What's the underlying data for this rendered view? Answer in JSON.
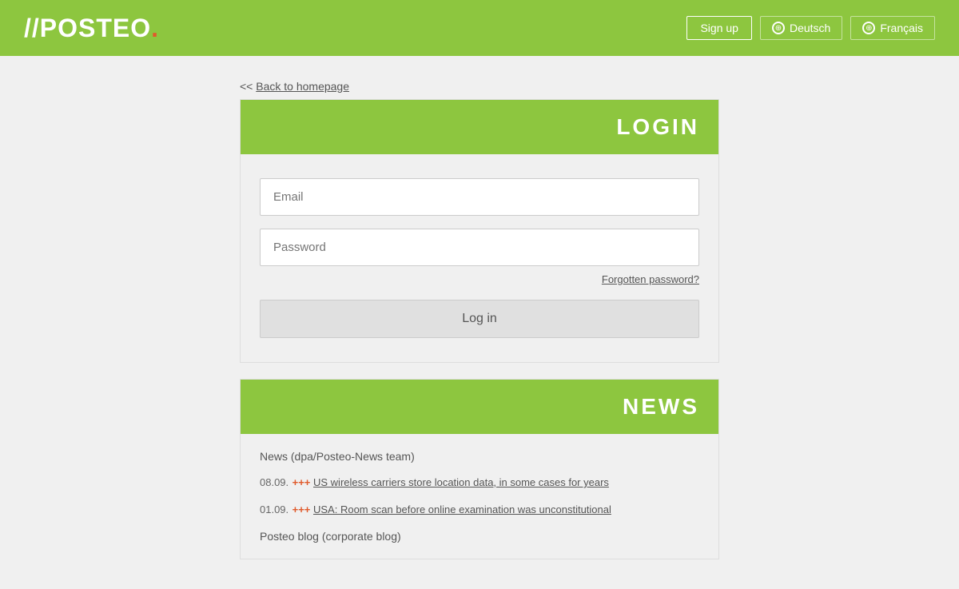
{
  "header": {
    "logo": "//POSTEO",
    "dot": ".",
    "signup_label": "Sign up",
    "lang_deutsch": "Deutsch",
    "lang_francais": "Français"
  },
  "back_link": {
    "prefix": "<< ",
    "label": "Back to homepage",
    "href": "#"
  },
  "login": {
    "title": "LOGIN",
    "email_placeholder": "Email",
    "password_placeholder": "Password",
    "forgot_label": "Forgotten password?",
    "login_button": "Log in"
  },
  "news": {
    "title": "NEWS",
    "source": "News (dpa/Posteo-News team)",
    "items": [
      {
        "date": "08.09.",
        "plus": "+++",
        "link_text": "US wireless carriers store location data, in some cases for years",
        "href": "#"
      },
      {
        "date": "01.09.",
        "plus": "+++",
        "link_text": "USA: Room scan before online examination was unconstitutional",
        "href": "#"
      }
    ],
    "blog_label": "Posteo blog (corporate blog)"
  }
}
